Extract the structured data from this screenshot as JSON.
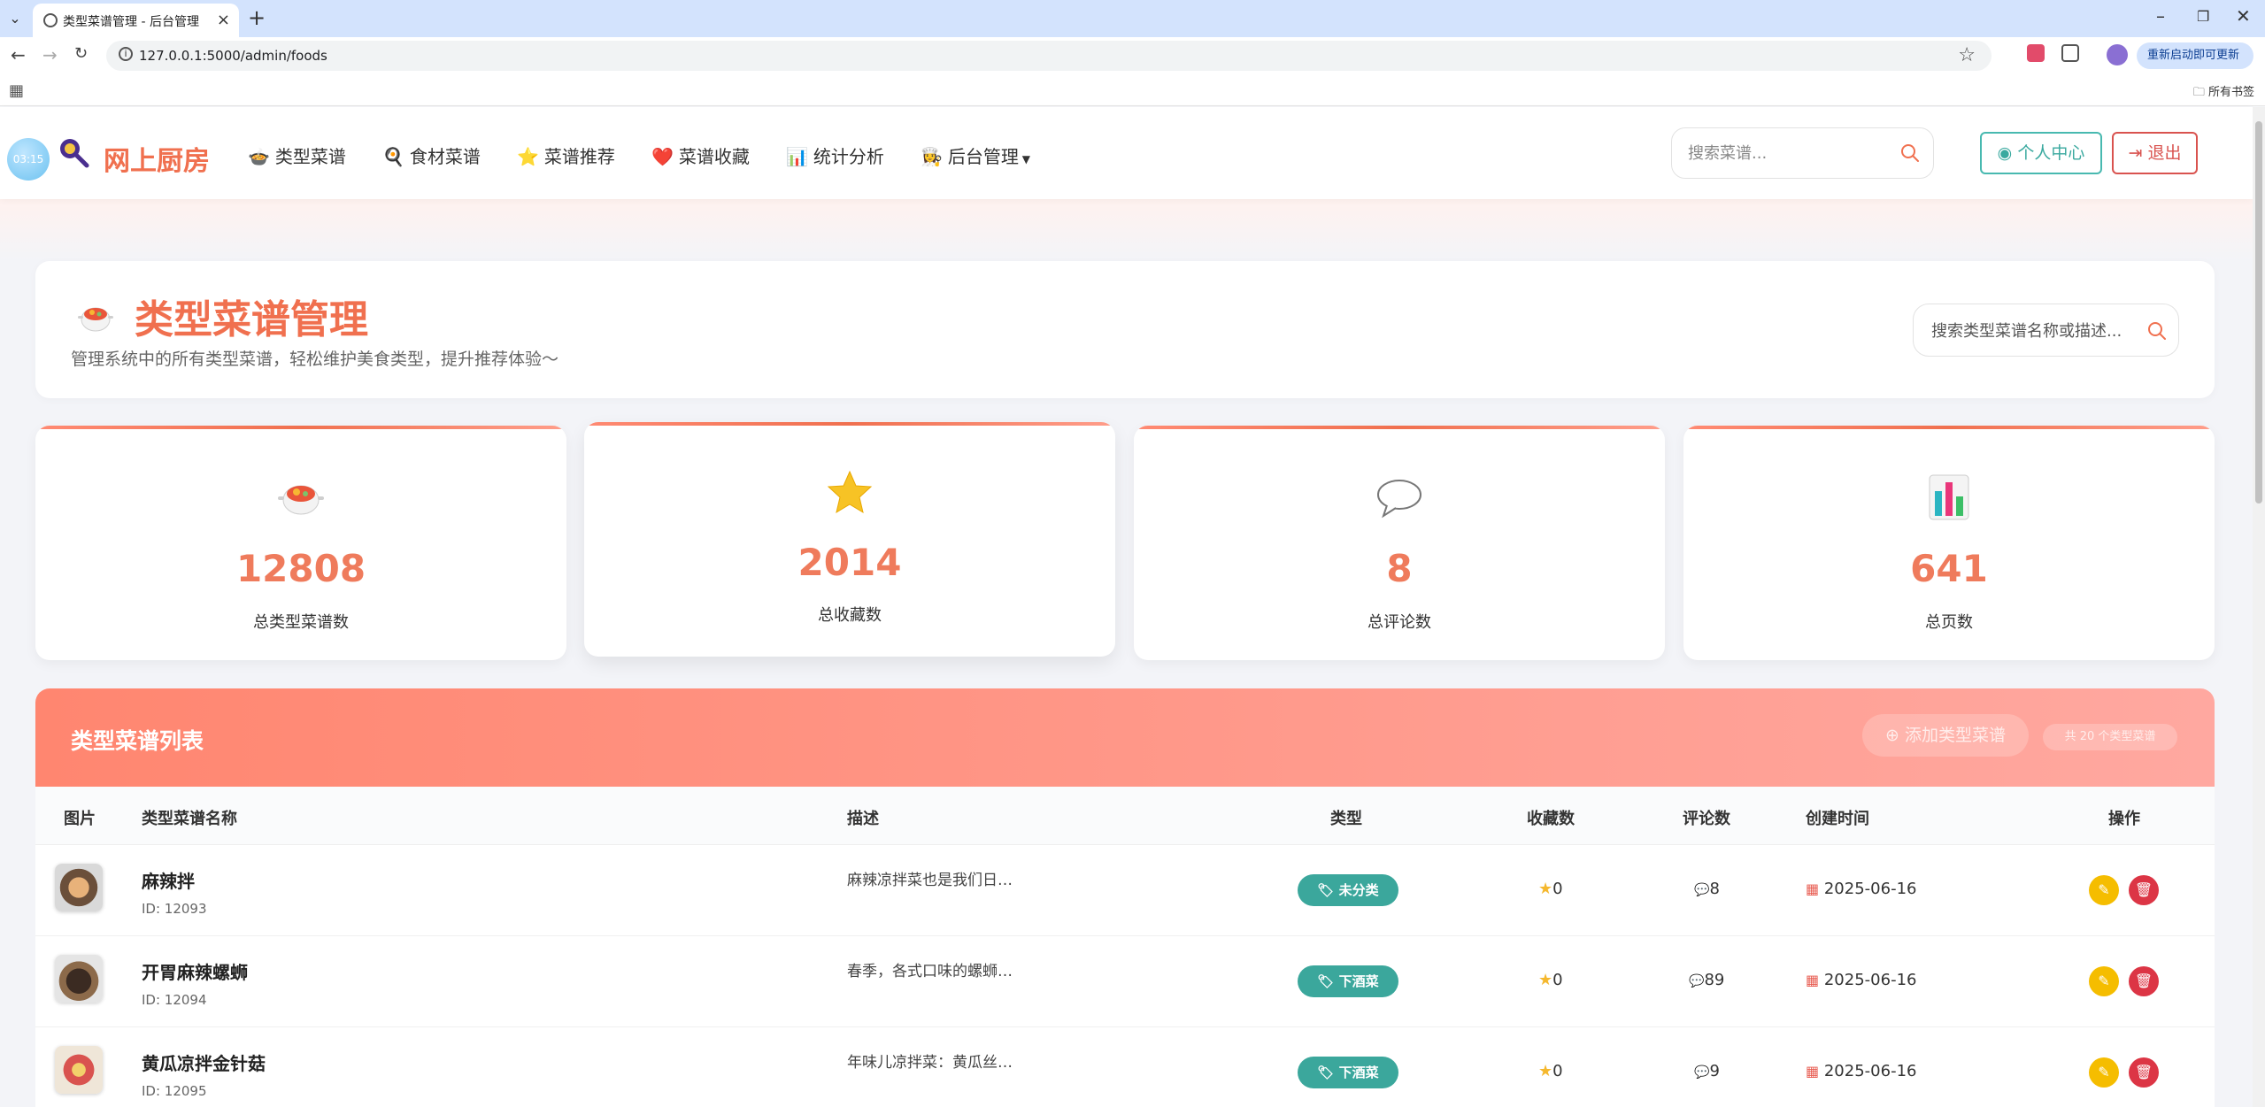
{
  "browser": {
    "tab_title": "类型菜谱管理 - 后台管理",
    "url": "127.0.0.1:5000/admin/foods",
    "update_label": "重新启动即可更新",
    "bookmarks_label": "所有书签"
  },
  "header": {
    "clock_time": "03:15",
    "site_title": "网上厨房",
    "menu": [
      {
        "icon": "🍲",
        "label": "类型菜谱"
      },
      {
        "icon": "🍳",
        "label": "食材菜谱"
      },
      {
        "icon": "⭐",
        "label": "菜谱推荐"
      },
      {
        "icon": "❤️",
        "label": "菜谱收藏"
      },
      {
        "icon": "📊",
        "label": "统计分析"
      },
      {
        "icon": "👩‍🍳",
        "label": "后台管理"
      }
    ],
    "search_placeholder": "搜索菜谱...",
    "profile_label": "个人中心",
    "logout_label": "退出"
  },
  "title_card": {
    "title": "类型菜谱管理",
    "description": "管理系统中的所有类型菜谱，轻松维护美食类型，提升推荐体验～",
    "search_placeholder": "搜索类型菜谱名称或描述..."
  },
  "stats": [
    {
      "icon": "pot-icon",
      "value": "12808",
      "label": "总类型菜谱数"
    },
    {
      "icon": "star-icon",
      "value": "2014",
      "label": "总收藏数"
    },
    {
      "icon": "speech-bubble-icon",
      "value": "8",
      "label": "总评论数"
    },
    {
      "icon": "bar-chart-icon",
      "value": "641",
      "label": "总页数"
    }
  ],
  "list": {
    "title": "类型菜谱列表",
    "add_label": "添加类型菜谱",
    "count_label": "共 20 个类型菜谱",
    "columns": [
      "图片",
      "类型菜谱名称",
      "描述",
      "类型",
      "收藏数",
      "评论数",
      "创建时间",
      "操作"
    ],
    "rows": [
      {
        "name": "麻辣拌",
        "id": "ID: 12093",
        "desc": "麻辣凉拌菜也是我们日…",
        "type": "未分类",
        "fav": "0",
        "comments": "8",
        "date": "2025-06-16"
      },
      {
        "name": "开胃麻辣螺蛳",
        "id": "ID: 12094",
        "desc": "春季，各式口味的螺蛳…",
        "type": "下酒菜",
        "fav": "0",
        "comments": "89",
        "date": "2025-06-16"
      },
      {
        "name": "黄瓜凉拌金针菇",
        "id": "ID: 12095",
        "desc": "年味儿凉拌菜：黄瓜丝…",
        "type": "下酒菜",
        "fav": "0",
        "comments": "9",
        "date": "2025-06-16"
      }
    ]
  },
  "colors": {
    "brand": "#f0704f",
    "header_gradient_start": "#ff8670",
    "header_gradient_end": "#ffa8a0",
    "tag": "#3ba79c",
    "edit": "#f5bd00",
    "delete": "#dc3545"
  }
}
